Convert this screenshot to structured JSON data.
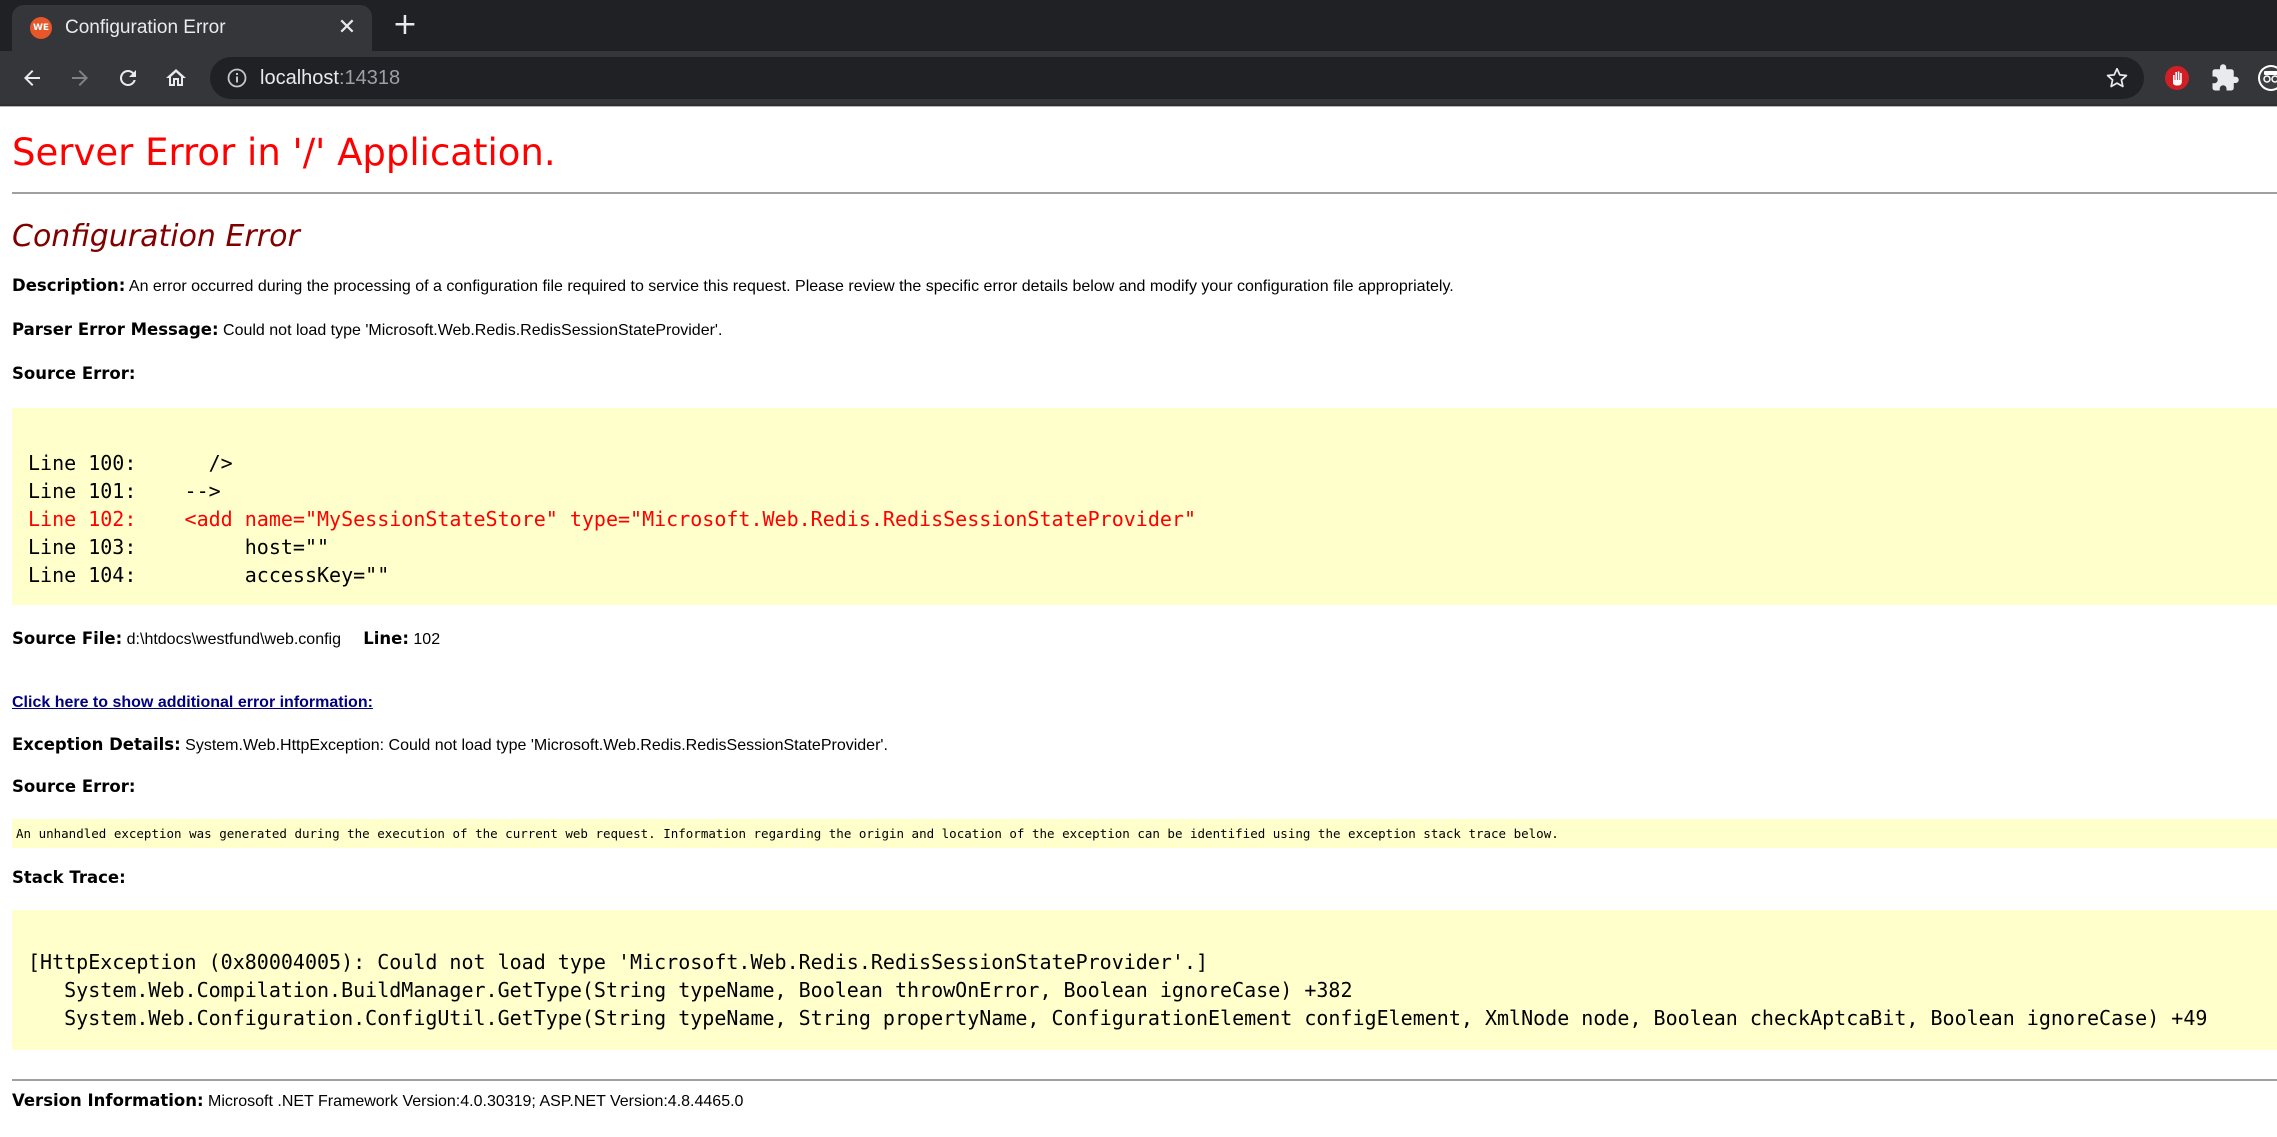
{
  "browser": {
    "tab_title": "Configuration Error",
    "favicon_text": "WE",
    "close_glyph": "✕",
    "newtab_glyph": "+",
    "url_host": "localhost",
    "url_port": ":14318",
    "icons": [
      "back-icon",
      "forward-icon",
      "reload-icon",
      "home-icon",
      "info-icon",
      "star-icon",
      "hand-extension-icon",
      "puzzle-extension-icon",
      "profile-icon"
    ]
  },
  "page": {
    "title": "Server Error in '/' Application.",
    "subtitle": "Configuration Error",
    "description_label": "Description:",
    "description_text": " An error occurred during the processing of a configuration file required to service this request. Please review the specific error details below and modify your configuration file appropriately.",
    "parser_label": "Parser Error Message:",
    "parser_text": " Could not load type 'Microsoft.Web.Redis.RedisSessionStateProvider'.",
    "source_error_label": "Source Error:",
    "source_lines": [
      "Line 100:      />",
      "Line 101:    -->",
      "Line 102:    <add name=\"MySessionStateStore\" type=\"Microsoft.Web.Redis.RedisSessionStateProvider\"",
      "Line 103:         host=\"\"",
      "Line 104:         accessKey=\"\""
    ],
    "source_file_label": "Source File:",
    "source_file_value": " d:\\htdocs\\westfund\\web.config",
    "line_label": "Line:",
    "line_value": " 102",
    "additional_link": "Click here to show additional error information:",
    "exception_label": "Exception Details:",
    "exception_text": " System.Web.HttpException: Could not load type 'Microsoft.Web.Redis.RedisSessionStateProvider'.",
    "source_error_label_2": "Source Error:",
    "unhandled_text": "An unhandled exception was generated during the execution of the current web request. Information regarding the origin and location of the exception can be identified using the exception stack trace below.",
    "stack_trace_label": "Stack Trace:",
    "stack_lines": [
      "[HttpException (0x80004005): Could not load type 'Microsoft.Web.Redis.RedisSessionStateProvider'.]",
      "   System.Web.Compilation.BuildManager.GetType(String typeName, Boolean throwOnError, Boolean ignoreCase) +382",
      "   System.Web.Configuration.ConfigUtil.GetType(String typeName, String propertyName, ConfigurationElement configElement, XmlNode node, Boolean checkAptcaBit, Boolean ignoreCase) +49"
    ],
    "version_label": "Version Information:",
    "version_text": " Microsoft .NET Framework Version:4.0.30319; ASP.NET Version:4.8.4465.0"
  }
}
